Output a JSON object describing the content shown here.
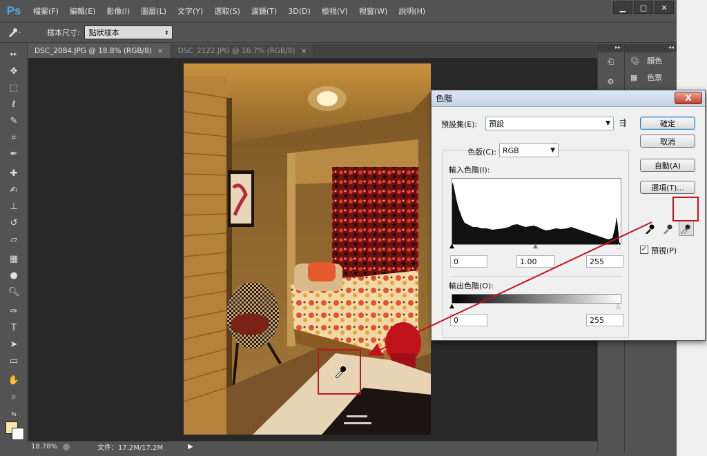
{
  "app": {
    "logo": "Ps",
    "menu": [
      "檔案(F)",
      "編輯(E)",
      "影像(I)",
      "圖層(L)",
      "文字(Y)",
      "選取(S)",
      "濾鏡(T)",
      "3D(D)",
      "檢視(V)",
      "視窗(W)",
      "說明(H)"
    ]
  },
  "options": {
    "sample_size_label": "樣本尺寸:",
    "sample_size_value": "點狀樣本"
  },
  "tabs": [
    {
      "label": "DSC_2084.JPG @ 18.8% (RGB/8)",
      "close": "×",
      "active": true
    },
    {
      "label": "DSC_2122.JPG @ 16.7% (RGB/8)",
      "close": "×",
      "active": false
    }
  ],
  "status": {
    "zoom": "18.78%",
    "doc": "文件：17.2M/17.2M"
  },
  "panels": {
    "color_label": "顏色",
    "swatches_label": "色票"
  },
  "dialog": {
    "title": "色階",
    "close": "X",
    "preset_label": "預設集(E):",
    "preset_value": "預設",
    "channel_label": "色版(C):",
    "channel_value": "RGB",
    "input_label": "輸入色階(I):",
    "input_black": "0",
    "input_gamma": "1.00",
    "input_white": "255",
    "output_label": "輸出色階(O):",
    "output_black": "0",
    "output_white": "255",
    "ok": "確定",
    "cancel": "取消",
    "auto": "自動(A)",
    "options": "選項(T)...",
    "preview_label": "預視(P)",
    "preview_checked": true
  }
}
